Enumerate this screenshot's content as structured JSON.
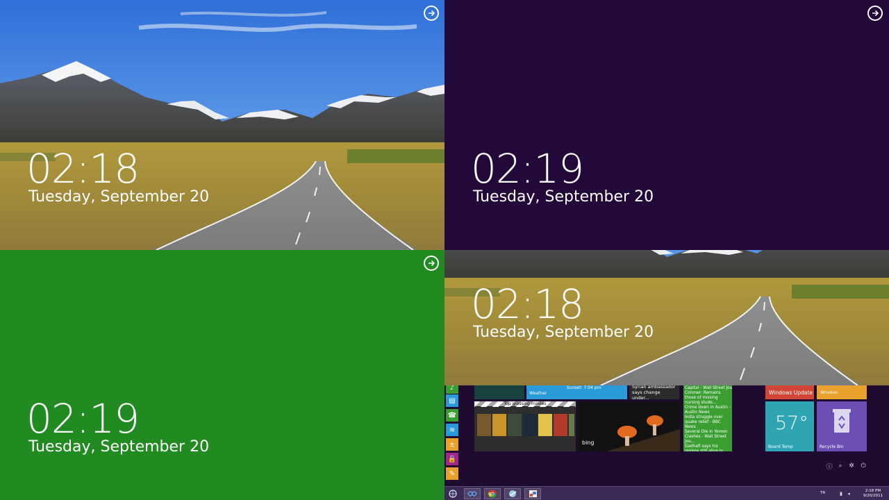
{
  "screens": [
    {
      "time": "02:18",
      "date": "Tuesday, September 20"
    },
    {
      "time": "02:19",
      "date": "Tuesday, September 20"
    },
    {
      "time": "02:19",
      "date": "Tuesday, September 20"
    },
    {
      "time": "02:18",
      "date": "Tuesday, September 20"
    }
  ],
  "colors": {
    "purple": "#23093a",
    "green": "#218b22",
    "start_bg": "#1f0b30",
    "taskbar": "#3b2a55",
    "tile_red": "#d04535",
    "tile_orange": "#e8a12c",
    "tile_teal": "#2fa5b3",
    "tile_violet": "#6b4fb5",
    "tile_green": "#3a9e32",
    "tile_blue": "#2a9bd8"
  },
  "start": {
    "weather_label": "Weather",
    "sunset": "Sunset: 7:04 pm",
    "news_top": "Syrian ambassador says change under...",
    "movies_title": "Top grossing movies",
    "bing_label": "bing",
    "news_items": [
      "Capital - Wall Street Jou...",
      "Coroner: Remains those of missing nursing stude...",
      "Crime down in Austin - Austin News",
      "India struggle over quake relief - BBC News",
      "Several Die in Yemen Clashes - Wall Street Jou...",
      "Gadhafi says his regime still alive in Libya - The..."
    ],
    "windows_update": "Windows Update",
    "wireless": "Wireless",
    "temp": "57°",
    "board_temp": "Board Temp",
    "recycle_bin": "Recycle Bin"
  },
  "taskbar": {
    "lang": "TR",
    "time": "2:18 PM",
    "date": "9/20/2011"
  },
  "icons": {
    "sign_in": "arrow-right-circle-icon",
    "chrome": "chrome-icon",
    "recycle": "recycle-icon"
  }
}
